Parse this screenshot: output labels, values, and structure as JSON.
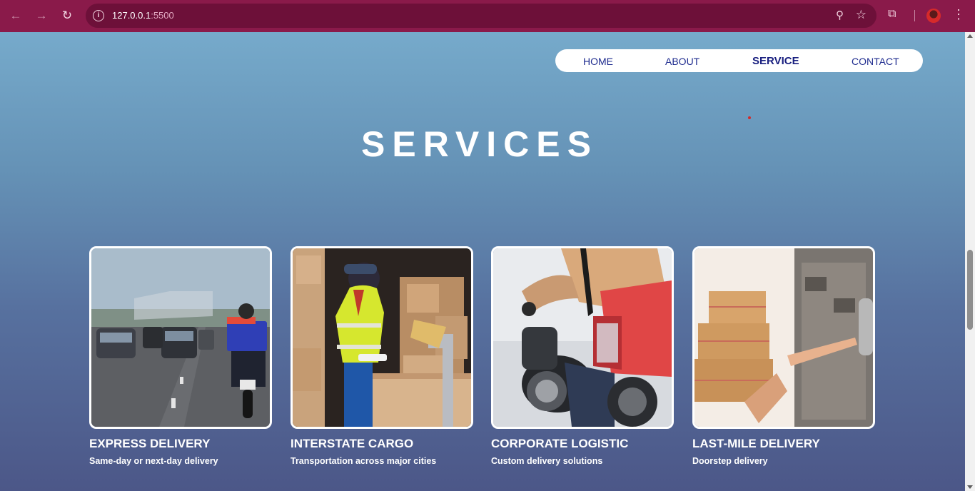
{
  "browser": {
    "url_host": "127.0.0.1",
    "url_port": ":5500"
  },
  "nav": {
    "items": [
      {
        "label": "HOME"
      },
      {
        "label": "ABOUT"
      },
      {
        "label": "SERVICE"
      },
      {
        "label": "CONTACT"
      }
    ],
    "active": "SERVICE"
  },
  "main": {
    "title": "SERVICES",
    "cards": [
      {
        "name": "EXPRESS DELIVERY",
        "desc": "Same-day or next-day delivery"
      },
      {
        "name": "INTERSTATE CARGO",
        "desc": "Transportation across major cities"
      },
      {
        "name": "CORPORATE LOGISTIC",
        "desc": "Custom delivery solutions"
      },
      {
        "name": "LAST-MILE DELIVERY",
        "desc": "Doorstep delivery"
      }
    ]
  },
  "colors": {
    "chrome": "#8a1a4a",
    "nav_text": "#1f2c8f",
    "gradient_top": "#76aacb",
    "gradient_bottom": "#4c5788"
  }
}
